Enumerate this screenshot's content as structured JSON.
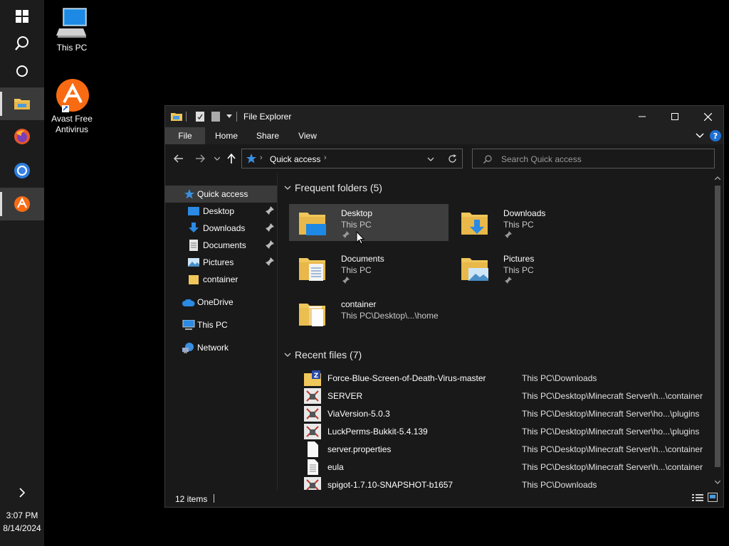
{
  "taskbar": {
    "clock_time": "3:07 PM",
    "clock_date": "8/14/2024"
  },
  "desktop": {
    "icons": [
      {
        "label": "This PC"
      },
      {
        "label": "Avast Free Antivirus"
      }
    ]
  },
  "window": {
    "title": "File Explorer",
    "ribbon_tabs": [
      "File",
      "Home",
      "Share",
      "View"
    ],
    "address": "Quick access",
    "search_placeholder": "Search Quick access",
    "nav": {
      "quick_access": "Quick access",
      "pinned": [
        "Desktop",
        "Downloads",
        "Documents",
        "Pictures"
      ],
      "container": "container",
      "onedrive": "OneDrive",
      "this_pc": "This PC",
      "network": "Network"
    },
    "frequent": {
      "header": "Frequent folders (5)",
      "folders": [
        {
          "name": "Desktop",
          "location": "This PC"
        },
        {
          "name": "Downloads",
          "location": "This PC"
        },
        {
          "name": "Documents",
          "location": "This PC"
        },
        {
          "name": "Pictures",
          "location": "This PC"
        },
        {
          "name": "container",
          "location": "This PC\\Desktop\\...\\home"
        }
      ]
    },
    "recent": {
      "header": "Recent files (7)",
      "files": [
        {
          "name": "Force-Blue-Screen-of-Death-Virus-master",
          "path": "This PC\\Downloads"
        },
        {
          "name": "SERVER",
          "path": "This PC\\Desktop\\Minecraft Server\\h...\\container"
        },
        {
          "name": "ViaVersion-5.0.3",
          "path": "This PC\\Desktop\\Minecraft Server\\ho...\\plugins"
        },
        {
          "name": "LuckPerms-Bukkit-5.4.139",
          "path": "This PC\\Desktop\\Minecraft Server\\ho...\\plugins"
        },
        {
          "name": "server.properties",
          "path": "This PC\\Desktop\\Minecraft Server\\h...\\container"
        },
        {
          "name": "eula",
          "path": "This PC\\Desktop\\Minecraft Server\\h...\\container"
        },
        {
          "name": "spigot-1.7.10-SNAPSHOT-b1657",
          "path": "This PC\\Downloads"
        }
      ]
    },
    "status": "12 items"
  },
  "colors": {
    "accent": "#0078d7",
    "folder": "#f0c75a",
    "window_bg": "#191919",
    "selection": "#3e3e3e"
  }
}
